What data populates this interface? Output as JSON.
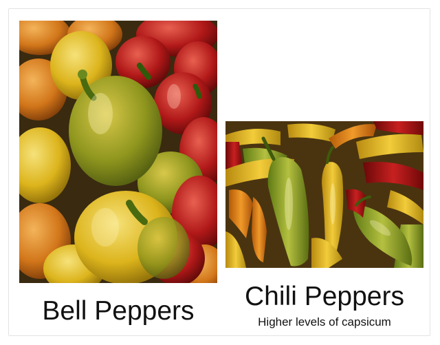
{
  "items": [
    {
      "title": "Bell Peppers",
      "subtitle": "",
      "image_icon": "bell-peppers-photo",
      "colors": {
        "green": "#8a9a1c",
        "yellow": "#e0b820",
        "orange": "#d9821a",
        "red": "#b01818"
      }
    },
    {
      "title": "Chili Peppers",
      "subtitle": "Higher levels of capsicum",
      "image_icon": "chili-peppers-photo",
      "colors": {
        "green": "#8fa02a",
        "yellow": "#e6b21e",
        "orange": "#e08a1c",
        "red": "#a81818"
      }
    }
  ]
}
